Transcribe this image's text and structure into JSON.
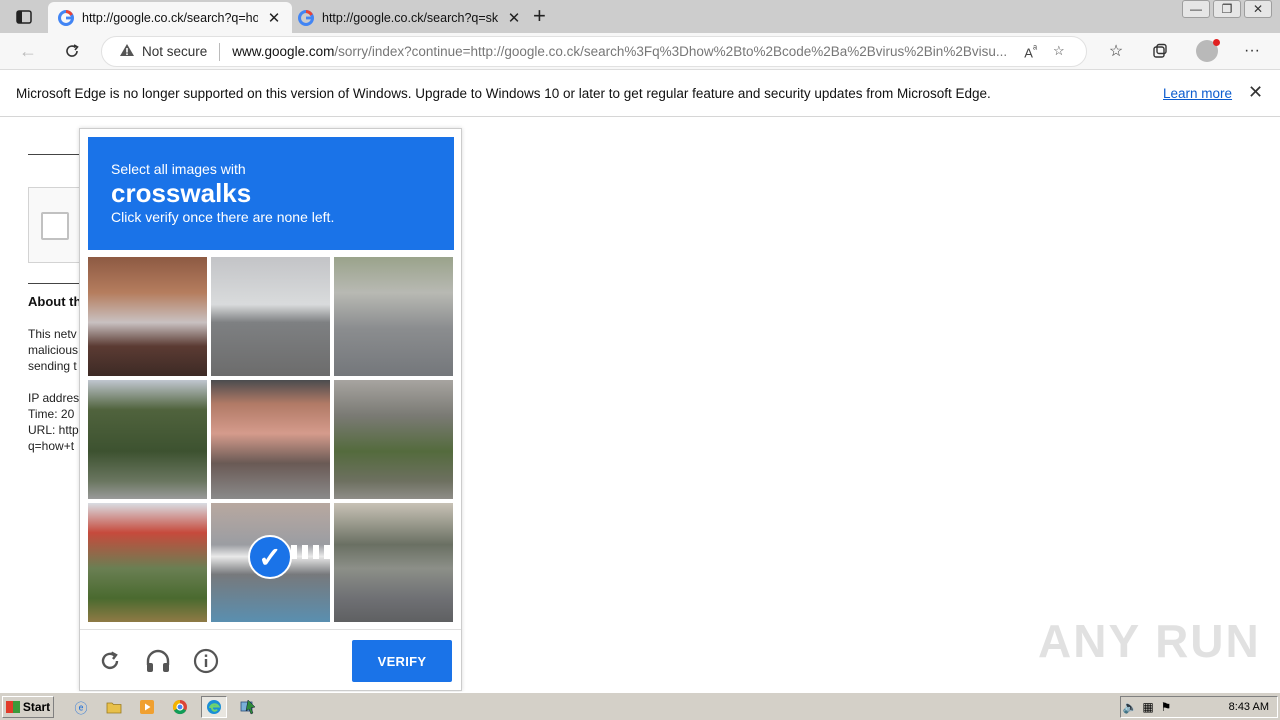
{
  "browser": {
    "tabs": [
      {
        "title": "http://google.co.ck/search?q=how",
        "active": true
      },
      {
        "title": "http://google.co.ck/search?q=sk",
        "active": false
      }
    ],
    "close_glyph": "✕",
    "new_tab_glyph": "+",
    "security_label": "Not secure",
    "url_host": "www.google.com",
    "url_rest": "/sorry/index?continue=http://google.co.ck/search%3Fq%3Dhow%2Bto%2Bcode%2Ba%2Bvirus%2Bin%2Bvisu...",
    "window_controls": [
      "—",
      "❐",
      "✕"
    ]
  },
  "infobar": {
    "message": "Microsoft Edge is no longer supported on this version of Windows. Upgrade to Windows 10 or later to get regular feature and security updates from Microsoft Edge.",
    "learn_more": "Learn more"
  },
  "page": {
    "about_heading": "About th",
    "lines": [
      "This netv",
      "malicious",
      "sending t",
      "IP addres",
      "Time: 20",
      "URL: http",
      "q=how+t"
    ]
  },
  "captcha": {
    "instruction": "Select all images with",
    "target": "crosswalks",
    "sub": "Click verify once there are none left.",
    "tiles": [
      {
        "selected": false
      },
      {
        "selected": false
      },
      {
        "selected": false
      },
      {
        "selected": false
      },
      {
        "selected": false
      },
      {
        "selected": false
      },
      {
        "selected": false
      },
      {
        "selected": true
      },
      {
        "selected": false
      }
    ],
    "verify_label": "VERIFY",
    "accent": "#1a73e8"
  },
  "watermark": "ANY RUN",
  "taskbar": {
    "start_label": "Start",
    "clock": "8:43 AM"
  }
}
